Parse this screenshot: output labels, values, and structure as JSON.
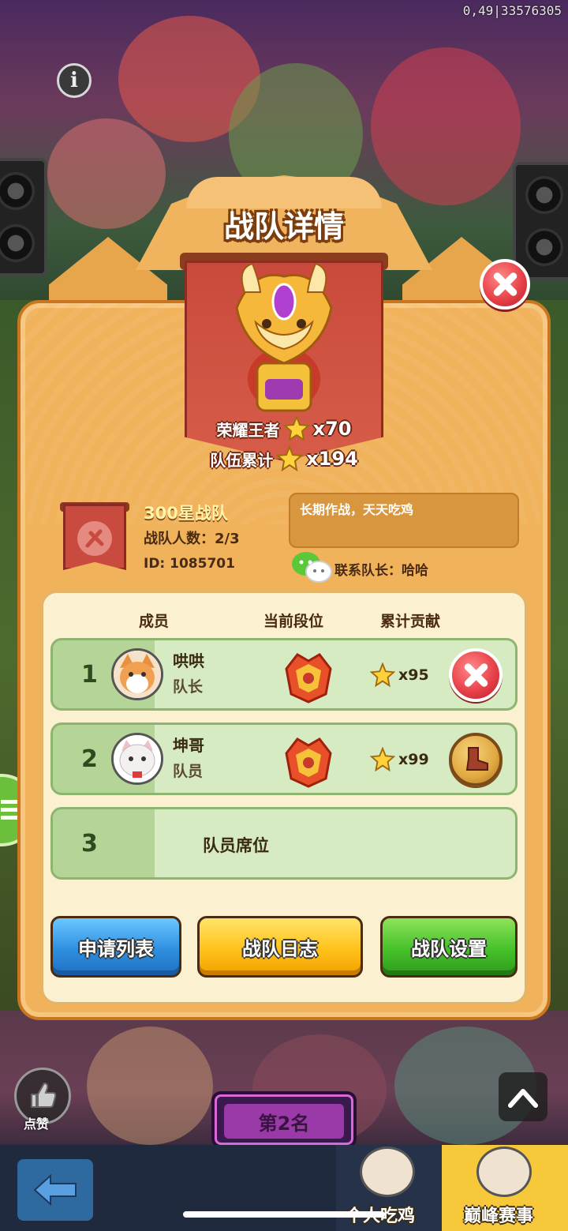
{
  "debug_text": "0,49|33576305",
  "dialog": {
    "title": "战队详情",
    "rank_title": "荣耀王者",
    "rank_stars": "x70",
    "team_total_label": "队伍累计",
    "team_total_stars": "x194"
  },
  "team": {
    "name": "300星战队",
    "member_count": "战队人数：2/3",
    "id": "ID: 1085701",
    "slogan": "长期作战，天天吃鸡",
    "contact": "联系队长：哈哈"
  },
  "table": {
    "headers": [
      "成员",
      "当前段位",
      "累计贡献"
    ],
    "members": [
      {
        "num": "1",
        "name": "哄哄",
        "role": "队长",
        "contrib": "x95",
        "action_icon": "close-icon"
      },
      {
        "num": "2",
        "name": "坤哥",
        "role": "队员",
        "contrib": "x99",
        "action_icon": "boot-icon"
      }
    ],
    "empty_seat": {
      "num": "3",
      "label": "队员席位"
    }
  },
  "buttons": {
    "apply_list": "申请列表",
    "team_log": "战队日志",
    "team_settings": "战队设置"
  },
  "bottom": {
    "like_label": "点赞",
    "rank_plate": "第2名",
    "tab_personal": "个人吃鸡",
    "tab_peak": "巅峰赛事"
  },
  "colors": {
    "panel": "#f0b25a",
    "banner": "#c94a3c",
    "blue_button": "#2e8fe0",
    "yellow_button": "#ffc21a",
    "green_button": "#45c22a",
    "close_red": "#e8424a"
  }
}
